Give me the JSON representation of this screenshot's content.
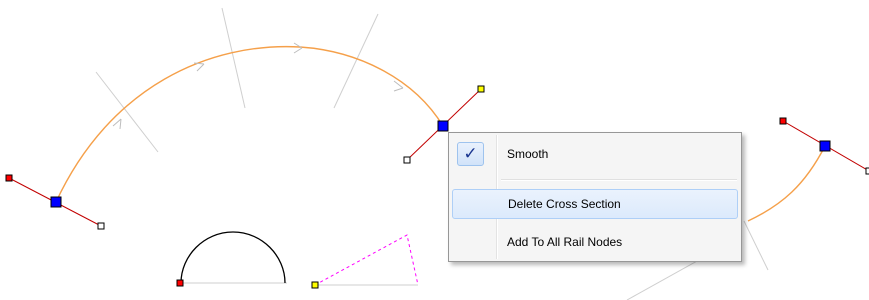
{
  "colors": {
    "rail_curve": "#f5a04a",
    "guide_line": "#cfcfcf",
    "handle_line": "#c20000",
    "selected_node": "#0000ff",
    "handle_start": "#ff0000",
    "handle_end": "#ffffff",
    "handle_alt": "#ffff00",
    "sector_dashed": "#ff00ff"
  },
  "context_menu": {
    "items": [
      {
        "label": "Smooth",
        "checked": true,
        "check_glyph": "✓",
        "icon": "check-icon"
      },
      {
        "label": "Delete Cross Section",
        "highlighted": true
      },
      {
        "label": "Add To All Rail Nodes"
      }
    ]
  }
}
